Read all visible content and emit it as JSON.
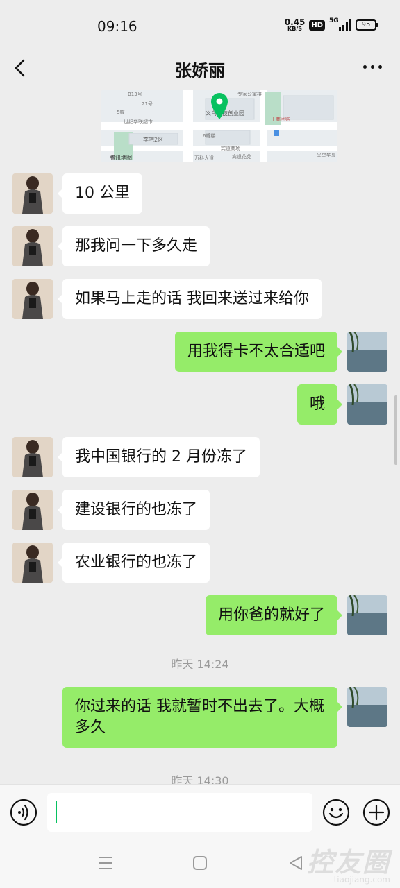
{
  "status_bar": {
    "time": "09:16",
    "net_speed_value": "0.45",
    "net_speed_unit": "KB/S",
    "hd_label": "HD",
    "network_label": "5G",
    "battery": "95"
  },
  "header": {
    "title": "张娇丽",
    "back_icon": "chevron-left-icon",
    "more_icon": "more-horizontal-icon"
  },
  "map": {
    "labels": [
      "B13号",
      "21号",
      "专家公寓楼",
      "5幢",
      "世纪华联超市",
      "义乌科技创业园",
      "正商团购",
      "李宅2区",
      "6幢楼",
      "万科大道",
      "宾道商场",
      "腾讯地图",
      "宾道花苑",
      "义乌华夏"
    ]
  },
  "messages": [
    {
      "side": "left",
      "text": "10 公里"
    },
    {
      "side": "left",
      "text": "那我问一下多久走"
    },
    {
      "side": "left",
      "text": "如果马上走的话 我回来送过来给你"
    },
    {
      "side": "right",
      "text": "用我得卡不太合适吧"
    },
    {
      "side": "right",
      "text": "哦"
    },
    {
      "side": "left",
      "text": "我中国银行的 2 月份冻了"
    },
    {
      "side": "left",
      "text": "建设银行的也冻了"
    },
    {
      "side": "left",
      "text": "农业银行的也冻了"
    },
    {
      "side": "right",
      "text": "用你爸的就好了"
    },
    {
      "side": "right",
      "text": "你过来的话 我就暂时不出去了。大概多久"
    }
  ],
  "timestamps": [
    "昨天 14:24",
    "昨天 14:30"
  ],
  "input_bar": {
    "voice_icon": "voice-icon",
    "input_value": "",
    "emoji_icon": "emoji-icon",
    "plus_icon": "plus-circle-icon"
  },
  "system_nav": {
    "menu_icon": "menu-icon",
    "home_icon": "home-square-icon",
    "back_icon": "back-triangle-icon"
  },
  "watermark": {
    "main": "控友圈",
    "sub": "tiaojiang.com"
  },
  "colors": {
    "sent_bubble": "#95ec69",
    "received_bubble": "#ffffff",
    "background": "#ededed",
    "accent": "#07c160"
  }
}
